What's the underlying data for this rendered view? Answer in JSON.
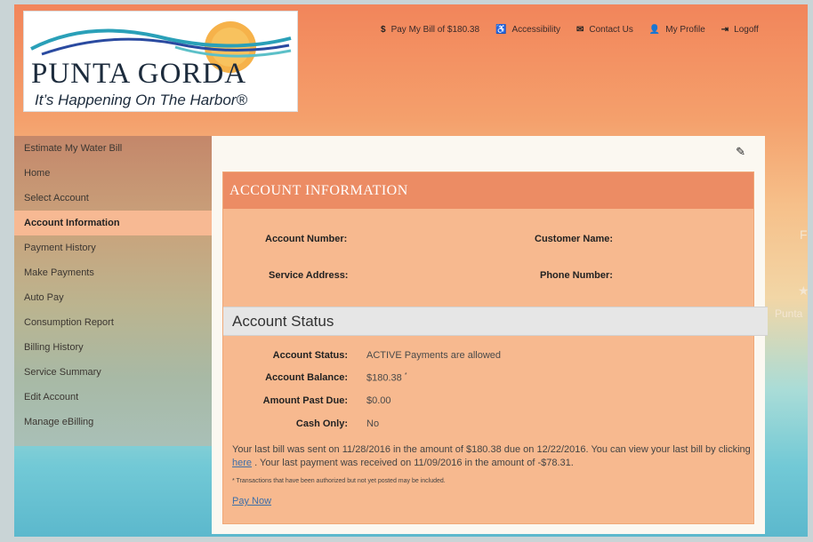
{
  "logo": {
    "title": "PUNTA GORDA",
    "tagline": "It’s Happening On The Harbor®"
  },
  "topnav": {
    "pay_bill": {
      "icon": "$",
      "label": "Pay My Bill of $180.38"
    },
    "accessibility": {
      "icon": "♿",
      "label": "Accessibility"
    },
    "contact": {
      "icon": "✉",
      "label": "Contact Us"
    },
    "profile": {
      "icon": "👤",
      "label": "My Profile"
    },
    "logoff": {
      "icon": "⇥",
      "label": "Logoff"
    }
  },
  "sidebar": {
    "items": [
      {
        "label": "Estimate My Water Bill"
      },
      {
        "label": "Home"
      },
      {
        "label": "Select Account"
      },
      {
        "label": "Account Information"
      },
      {
        "label": "Payment History"
      },
      {
        "label": "Make Payments"
      },
      {
        "label": "Auto Pay"
      },
      {
        "label": "Consumption Report"
      },
      {
        "label": "Billing History"
      },
      {
        "label": "Service Summary"
      },
      {
        "label": "Edit Account"
      },
      {
        "label": "Manage eBilling"
      }
    ],
    "active": "Account Information"
  },
  "account_info": {
    "header": "ACCOUNT INFORMATION",
    "account_number_label": "Account Number:",
    "customer_name_label": "Customer Name:",
    "service_address_label": "Service Address:",
    "phone_number_label": "Phone Number:"
  },
  "account_status": {
    "header": "Account Status",
    "rows": [
      {
        "label": "Account Status:",
        "value": "ACTIVE Payments are allowed"
      },
      {
        "label": "Account Balance:",
        "value": "$180.38",
        "marker": "*"
      },
      {
        "label": "Amount Past Due:",
        "value": "$0.00"
      },
      {
        "label": "Cash Only:",
        "value": "No"
      }
    ],
    "notice_part1": "Your last bill was sent on 11/28/2016 in the amount of $180.38 due on 12/22/2016. You can view your last bill by clicking ",
    "notice_link": "here",
    "notice_part2": " . Your last payment was received on 11/09/2016 in the amount of -$78.31.",
    "footnote": "* Transactions that have been authorized but not yet posted may be included.",
    "pay_now": "Pay Now"
  },
  "background_text": {
    "letter": "F",
    "word": "Punta"
  },
  "colors": {
    "header_salmon": "#ec8c64",
    "panel_peach": "#f7b98f",
    "active_item": "#f7b993",
    "link_blue": "#3d6fa8"
  }
}
